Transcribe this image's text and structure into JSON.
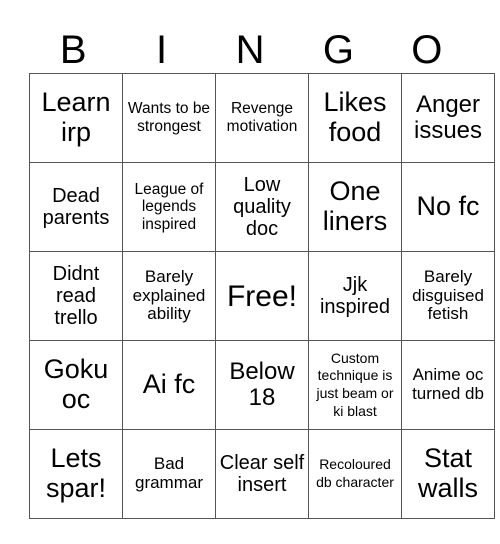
{
  "header": [
    "B",
    "I",
    "N",
    "G",
    "O"
  ],
  "rows": [
    [
      {
        "text": "Learn irp",
        "size": "s1"
      },
      {
        "text": "Wants to be strongest",
        "size": "s5"
      },
      {
        "text": "Revenge motivation",
        "size": "s5"
      },
      {
        "text": "Likes food",
        "size": "s1"
      },
      {
        "text": "Anger issues",
        "size": "s2"
      }
    ],
    [
      {
        "text": "Dead parents",
        "size": "s3"
      },
      {
        "text": "League of legends inspired",
        "size": "s5"
      },
      {
        "text": "Low quality doc",
        "size": "s3"
      },
      {
        "text": "One liners",
        "size": "s1"
      },
      {
        "text": "No fc",
        "size": "s1"
      }
    ],
    [
      {
        "text": "Didnt read trello",
        "size": "s3"
      },
      {
        "text": "Barely explained ability",
        "size": "s4"
      },
      {
        "text": "Free!",
        "size": "free"
      },
      {
        "text": "Jjk inspired",
        "size": "s3"
      },
      {
        "text": "Barely disguised fetish",
        "size": "s4"
      }
    ],
    [
      {
        "text": "Goku oc",
        "size": "s1"
      },
      {
        "text": "Ai fc",
        "size": "s1"
      },
      {
        "text": "Below 18",
        "size": "s2"
      },
      {
        "text": "Custom technique is just beam or ki blast",
        "size": "s6"
      },
      {
        "text": "Anime oc turned db",
        "size": "s4"
      }
    ],
    [
      {
        "text": "Lets spar!",
        "size": "s1"
      },
      {
        "text": "Bad grammar",
        "size": "s4"
      },
      {
        "text": "Clear self insert",
        "size": "s3"
      },
      {
        "text": "Recoloured db character",
        "size": "s6"
      },
      {
        "text": "Stat walls",
        "size": "s1"
      }
    ]
  ]
}
